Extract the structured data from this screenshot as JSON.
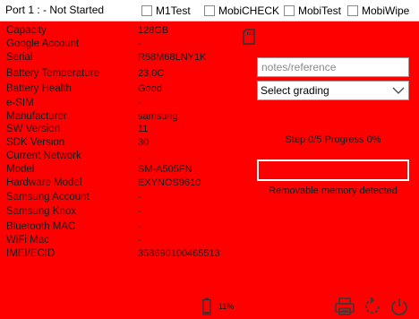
{
  "header": {
    "title": "Port 1 : - Not Started",
    "options": [
      {
        "label": "M1Test",
        "checked": false
      },
      {
        "label": "MobiCHECK",
        "checked": false
      },
      {
        "label": "MobiTest",
        "checked": false
      },
      {
        "label": "MobiWipe",
        "checked": false
      }
    ]
  },
  "device_info": [
    {
      "label": "Capacity",
      "value": "128GB"
    },
    {
      "label": "Google Account",
      "value": "-"
    },
    {
      "label": "Serial",
      "value": "R58M68LNY1K"
    },
    {
      "label": "Battery Temperature",
      "value": "23,0C"
    },
    {
      "label": "Battery Health",
      "value": "Good"
    },
    {
      "label": "e-SIM",
      "value": "-"
    },
    {
      "label": "Manufacturer",
      "value": "samsung"
    },
    {
      "label": "SW Version",
      "value": "11"
    },
    {
      "label": "SDK Version",
      "value": "30"
    },
    {
      "label": "Current Network",
      "value": ","
    },
    {
      "label": "Model",
      "value": "SM-A505FN"
    },
    {
      "label": "Hardware Model",
      "value": "EXYNOS9610"
    },
    {
      "label": "Samsung Account",
      "value": "-"
    },
    {
      "label": "Samsung Knox",
      "value": "-"
    },
    {
      "label": "Bluetooth MAC",
      "value": "-"
    },
    {
      "label": "WiFi Mac",
      "value": "-"
    },
    {
      "label": "IMEI/ECID",
      "value": "358690100465513"
    }
  ],
  "notes": {
    "placeholder": "notes/reference",
    "value": ""
  },
  "grading": {
    "selected": "Select grading"
  },
  "status": {
    "step_text": "Step 0/5 Progress 0%",
    "progress": 0,
    "removable_text": "Removable memory detected"
  },
  "battery": {
    "level_text": "11%"
  },
  "icons": {
    "sd_card": "sd-card-icon",
    "battery": "battery-icon",
    "print": "printer-icon",
    "refresh": "refresh-icon",
    "power": "power-icon"
  },
  "colors": {
    "panel_background": "#ff0000",
    "header_background": "#ffffff",
    "text": "#1a1a1a"
  }
}
